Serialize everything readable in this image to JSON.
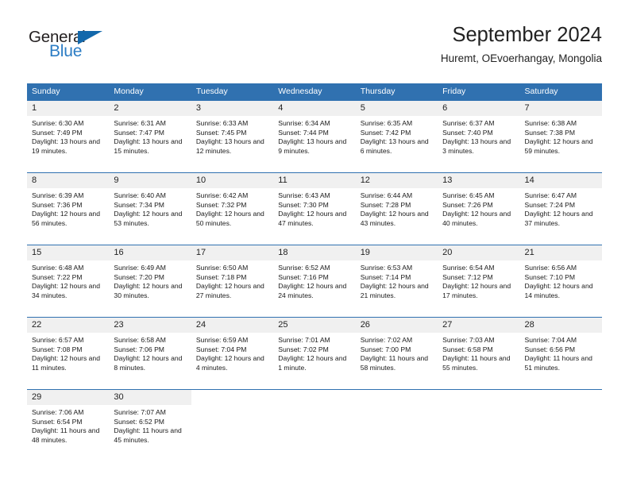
{
  "brand": {
    "name_top": "General",
    "name_bottom": "Blue",
    "triangle_icon": "blue-triangle-icon",
    "color_text": "#231f20",
    "color_accent": "#2b7cc4"
  },
  "header": {
    "month_title": "September 2024",
    "location": "Huremt, OEvoerhangay, Mongolia"
  },
  "theme": {
    "header_blue": "#3071b0",
    "daynum_background": "#f0f0f0",
    "cell_background": "#ffffff",
    "text": "#1a1a1a"
  },
  "calendar": {
    "weekday_headers": [
      "Sunday",
      "Monday",
      "Tuesday",
      "Wednesday",
      "Thursday",
      "Friday",
      "Saturday"
    ],
    "labels": {
      "sunrise": "Sunrise:",
      "sunset": "Sunset:",
      "daylight": "Daylight:"
    },
    "weeks": [
      [
        {
          "day": "1",
          "sunrise": "Sunrise: 6:30 AM",
          "sunset": "Sunset: 7:49 PM",
          "daylight": "Daylight: 13 hours and 19 minutes."
        },
        {
          "day": "2",
          "sunrise": "Sunrise: 6:31 AM",
          "sunset": "Sunset: 7:47 PM",
          "daylight": "Daylight: 13 hours and 15 minutes."
        },
        {
          "day": "3",
          "sunrise": "Sunrise: 6:33 AM",
          "sunset": "Sunset: 7:45 PM",
          "daylight": "Daylight: 13 hours and 12 minutes."
        },
        {
          "day": "4",
          "sunrise": "Sunrise: 6:34 AM",
          "sunset": "Sunset: 7:44 PM",
          "daylight": "Daylight: 13 hours and 9 minutes."
        },
        {
          "day": "5",
          "sunrise": "Sunrise: 6:35 AM",
          "sunset": "Sunset: 7:42 PM",
          "daylight": "Daylight: 13 hours and 6 minutes."
        },
        {
          "day": "6",
          "sunrise": "Sunrise: 6:37 AM",
          "sunset": "Sunset: 7:40 PM",
          "daylight": "Daylight: 13 hours and 3 minutes."
        },
        {
          "day": "7",
          "sunrise": "Sunrise: 6:38 AM",
          "sunset": "Sunset: 7:38 PM",
          "daylight": "Daylight: 12 hours and 59 minutes."
        }
      ],
      [
        {
          "day": "8",
          "sunrise": "Sunrise: 6:39 AM",
          "sunset": "Sunset: 7:36 PM",
          "daylight": "Daylight: 12 hours and 56 minutes."
        },
        {
          "day": "9",
          "sunrise": "Sunrise: 6:40 AM",
          "sunset": "Sunset: 7:34 PM",
          "daylight": "Daylight: 12 hours and 53 minutes."
        },
        {
          "day": "10",
          "sunrise": "Sunrise: 6:42 AM",
          "sunset": "Sunset: 7:32 PM",
          "daylight": "Daylight: 12 hours and 50 minutes."
        },
        {
          "day": "11",
          "sunrise": "Sunrise: 6:43 AM",
          "sunset": "Sunset: 7:30 PM",
          "daylight": "Daylight: 12 hours and 47 minutes."
        },
        {
          "day": "12",
          "sunrise": "Sunrise: 6:44 AM",
          "sunset": "Sunset: 7:28 PM",
          "daylight": "Daylight: 12 hours and 43 minutes."
        },
        {
          "day": "13",
          "sunrise": "Sunrise: 6:45 AM",
          "sunset": "Sunset: 7:26 PM",
          "daylight": "Daylight: 12 hours and 40 minutes."
        },
        {
          "day": "14",
          "sunrise": "Sunrise: 6:47 AM",
          "sunset": "Sunset: 7:24 PM",
          "daylight": "Daylight: 12 hours and 37 minutes."
        }
      ],
      [
        {
          "day": "15",
          "sunrise": "Sunrise: 6:48 AM",
          "sunset": "Sunset: 7:22 PM",
          "daylight": "Daylight: 12 hours and 34 minutes."
        },
        {
          "day": "16",
          "sunrise": "Sunrise: 6:49 AM",
          "sunset": "Sunset: 7:20 PM",
          "daylight": "Daylight: 12 hours and 30 minutes."
        },
        {
          "day": "17",
          "sunrise": "Sunrise: 6:50 AM",
          "sunset": "Sunset: 7:18 PM",
          "daylight": "Daylight: 12 hours and 27 minutes."
        },
        {
          "day": "18",
          "sunrise": "Sunrise: 6:52 AM",
          "sunset": "Sunset: 7:16 PM",
          "daylight": "Daylight: 12 hours and 24 minutes."
        },
        {
          "day": "19",
          "sunrise": "Sunrise: 6:53 AM",
          "sunset": "Sunset: 7:14 PM",
          "daylight": "Daylight: 12 hours and 21 minutes."
        },
        {
          "day": "20",
          "sunrise": "Sunrise: 6:54 AM",
          "sunset": "Sunset: 7:12 PM",
          "daylight": "Daylight: 12 hours and 17 minutes."
        },
        {
          "day": "21",
          "sunrise": "Sunrise: 6:56 AM",
          "sunset": "Sunset: 7:10 PM",
          "daylight": "Daylight: 12 hours and 14 minutes."
        }
      ],
      [
        {
          "day": "22",
          "sunrise": "Sunrise: 6:57 AM",
          "sunset": "Sunset: 7:08 PM",
          "daylight": "Daylight: 12 hours and 11 minutes."
        },
        {
          "day": "23",
          "sunrise": "Sunrise: 6:58 AM",
          "sunset": "Sunset: 7:06 PM",
          "daylight": "Daylight: 12 hours and 8 minutes."
        },
        {
          "day": "24",
          "sunrise": "Sunrise: 6:59 AM",
          "sunset": "Sunset: 7:04 PM",
          "daylight": "Daylight: 12 hours and 4 minutes."
        },
        {
          "day": "25",
          "sunrise": "Sunrise: 7:01 AM",
          "sunset": "Sunset: 7:02 PM",
          "daylight": "Daylight: 12 hours and 1 minute."
        },
        {
          "day": "26",
          "sunrise": "Sunrise: 7:02 AM",
          "sunset": "Sunset: 7:00 PM",
          "daylight": "Daylight: 11 hours and 58 minutes."
        },
        {
          "day": "27",
          "sunrise": "Sunrise: 7:03 AM",
          "sunset": "Sunset: 6:58 PM",
          "daylight": "Daylight: 11 hours and 55 minutes."
        },
        {
          "day": "28",
          "sunrise": "Sunrise: 7:04 AM",
          "sunset": "Sunset: 6:56 PM",
          "daylight": "Daylight: 11 hours and 51 minutes."
        }
      ],
      [
        {
          "day": "29",
          "sunrise": "Sunrise: 7:06 AM",
          "sunset": "Sunset: 6:54 PM",
          "daylight": "Daylight: 11 hours and 48 minutes."
        },
        {
          "day": "30",
          "sunrise": "Sunrise: 7:07 AM",
          "sunset": "Sunset: 6:52 PM",
          "daylight": "Daylight: 11 hours and 45 minutes."
        },
        {
          "day": "",
          "sunrise": "",
          "sunset": "",
          "daylight": ""
        },
        {
          "day": "",
          "sunrise": "",
          "sunset": "",
          "daylight": ""
        },
        {
          "day": "",
          "sunrise": "",
          "sunset": "",
          "daylight": ""
        },
        {
          "day": "",
          "sunrise": "",
          "sunset": "",
          "daylight": ""
        },
        {
          "day": "",
          "sunrise": "",
          "sunset": "",
          "daylight": ""
        }
      ]
    ]
  }
}
